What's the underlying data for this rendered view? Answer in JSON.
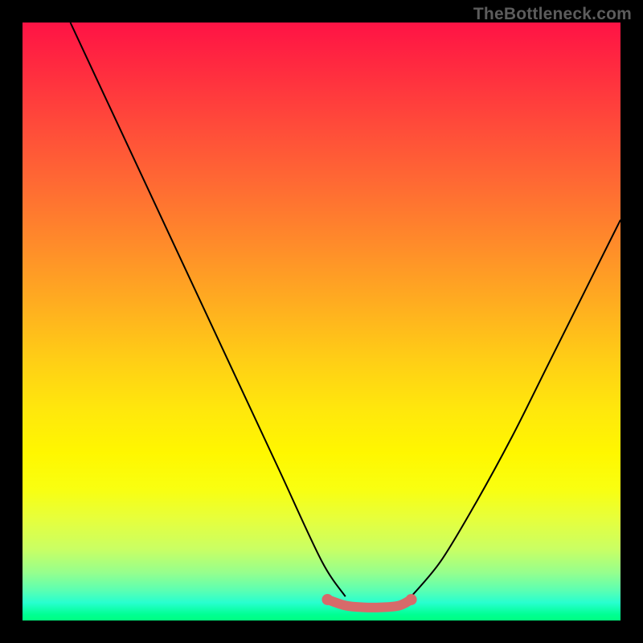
{
  "watermark": "TheBottleneck.com",
  "chart_data": {
    "type": "line",
    "title": "",
    "xlabel": "",
    "ylabel": "",
    "xlim": [
      0,
      100
    ],
    "ylim": [
      0,
      100
    ],
    "series": [
      {
        "name": "left-curve",
        "x": [
          8,
          15,
          22,
          29,
          36,
          43,
          50,
          54
        ],
        "values": [
          100,
          85,
          70,
          55,
          40,
          25,
          10,
          4
        ]
      },
      {
        "name": "right-curve",
        "x": [
          65,
          70,
          76,
          82,
          88,
          94,
          100
        ],
        "values": [
          4,
          10,
          20,
          31,
          43,
          55,
          67
        ]
      },
      {
        "name": "bottom-band",
        "x": [
          51,
          54,
          57,
          60,
          63,
          65
        ],
        "values": [
          3.5,
          2.5,
          2.2,
          2.2,
          2.5,
          3.5
        ]
      }
    ],
    "colors": {
      "curve": "#000000",
      "band": "#d76a6a",
      "gradient_top": "#ff1345",
      "gradient_bottom": "#00ff80"
    }
  }
}
